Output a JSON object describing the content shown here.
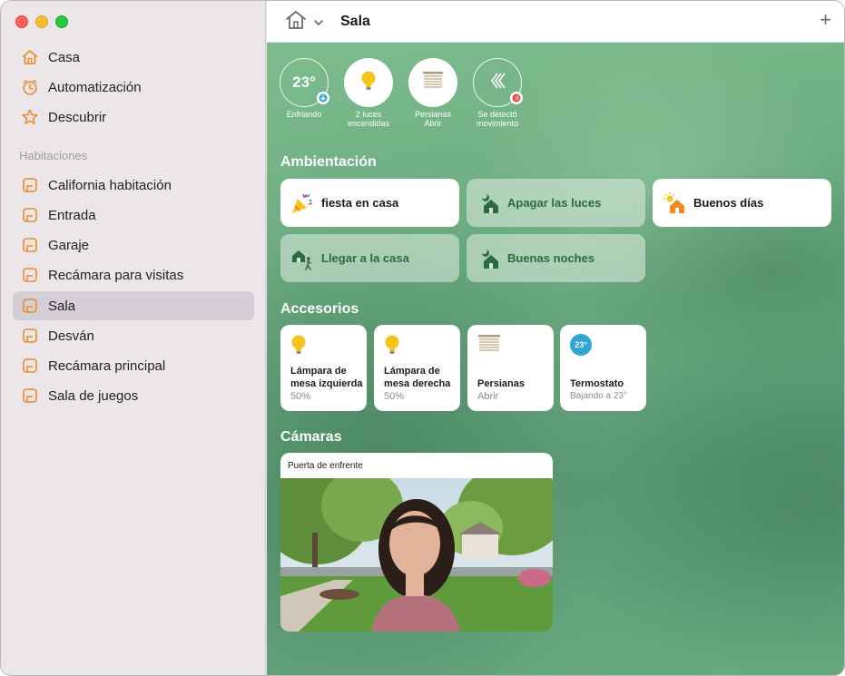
{
  "sidebar": {
    "nav": [
      {
        "label": "Casa",
        "icon": "house-icon"
      },
      {
        "label": "Automatización",
        "icon": "clock-icon"
      },
      {
        "label": "Descubrir",
        "icon": "star-icon"
      }
    ],
    "rooms_title": "Habitaciones",
    "rooms": [
      {
        "label": "California habitación"
      },
      {
        "label": "Entrada"
      },
      {
        "label": "Garaje"
      },
      {
        "label": "Recámara para visitas"
      },
      {
        "label": "Sala",
        "selected": true
      },
      {
        "label": "Desván"
      },
      {
        "label": "Recámara principal"
      },
      {
        "label": "Sala de juegos"
      }
    ]
  },
  "topbar": {
    "title": "Sala",
    "add_label": "+"
  },
  "status": [
    {
      "value": "23°",
      "label_line1": "Enfriando",
      "label_line2": ""
    },
    {
      "value": "",
      "label_line1": "2 luces",
      "label_line2": "encendidas"
    },
    {
      "value": "",
      "label_line1": "Persianas",
      "label_line2": "Abrir"
    },
    {
      "value": "",
      "label_line1": "Se detectó",
      "label_line2": "movimiento"
    }
  ],
  "headings": {
    "scenes": "Ambientación",
    "accessories": "Accesorios",
    "cameras": "Cámaras"
  },
  "scenes": [
    {
      "label": "fiesta en casa",
      "active": true,
      "icon": "party-popper-icon"
    },
    {
      "label": "Apagar las luces",
      "active": false,
      "icon": "house-moon-icon"
    },
    {
      "label": "Buenos días",
      "active": true,
      "icon": "house-sun-icon"
    },
    {
      "label": "Llegar a la casa",
      "active": false,
      "icon": "house-person-icon"
    },
    {
      "label": "Buenas noches",
      "active": false,
      "icon": "house-moon-icon"
    }
  ],
  "accessories": [
    {
      "name_line1": "Lámpara de",
      "name_line2": "mesa izquierda",
      "status": "50%",
      "icon": "lightbulb-icon"
    },
    {
      "name_line1": "Lámpara de",
      "name_line2": "mesa derecha",
      "status": "50%",
      "icon": "lightbulb-icon"
    },
    {
      "name_line1": "Persianas",
      "name_line2": "",
      "status": "Abrir",
      "icon": "blinds-icon"
    },
    {
      "name_line1": "Termostato",
      "name_line2": "",
      "status": "Bajando a 23°",
      "icon": "thermostat-icon",
      "badge": "23°"
    }
  ],
  "camera": {
    "title": "Puerta de enfrente"
  },
  "colors": {
    "accent_orange": "#f08a24",
    "bulb_yellow": "#f7c21a",
    "scene_green": "#2c6b3d",
    "thermo_blue": "#2fa6d6"
  }
}
